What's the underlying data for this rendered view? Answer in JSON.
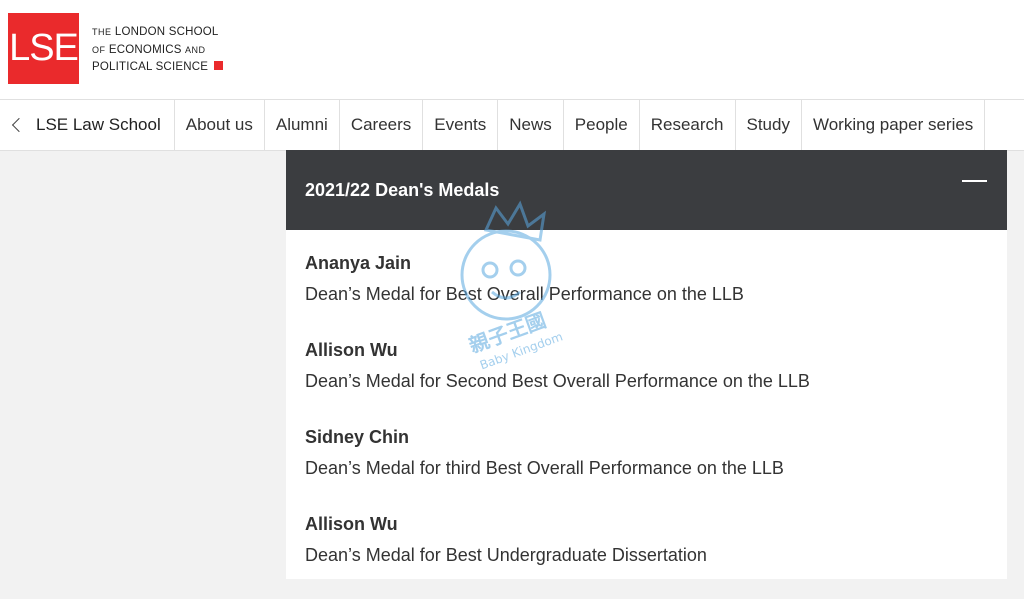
{
  "header": {
    "logo_text": "LSE",
    "school_name_line1_prefix": "THE",
    "school_name_line1": "LONDON SCHOOL",
    "school_name_line2_prefix": "OF",
    "school_name_line2": "ECONOMICS",
    "school_name_line2_suffix": "AND",
    "school_name_line3": "POLITICAL SCIENCE",
    "brand_color": "#ea2a2c"
  },
  "nav": {
    "back_label": "LSE Law School",
    "items": [
      {
        "label": "About us"
      },
      {
        "label": "Alumni"
      },
      {
        "label": "Careers"
      },
      {
        "label": "Events"
      },
      {
        "label": "News"
      },
      {
        "label": "People"
      },
      {
        "label": "Research"
      },
      {
        "label": "Study"
      },
      {
        "label": "Working paper series"
      }
    ]
  },
  "panel": {
    "title": "2021/22 Dean's Medals",
    "header_color": "#3b3d40",
    "entries": [
      {
        "name": "Ananya Jain",
        "award": "Dean’s Medal for Best Overall Performance on the LLB"
      },
      {
        "name": "Allison Wu",
        "award": "Dean’s Medal for Second Best Overall Performance on the LLB"
      },
      {
        "name": "Sidney Chin",
        "award": "Dean’s Medal for third Best Overall Performance on the LLB"
      },
      {
        "name": "Allison Wu",
        "award": "Dean’s Medal for Best Undergraduate Dissertation"
      }
    ]
  },
  "watermark": {
    "text_cn": "親子王國",
    "text_en": "Baby Kingdom",
    "color": "#5aa8e0"
  }
}
